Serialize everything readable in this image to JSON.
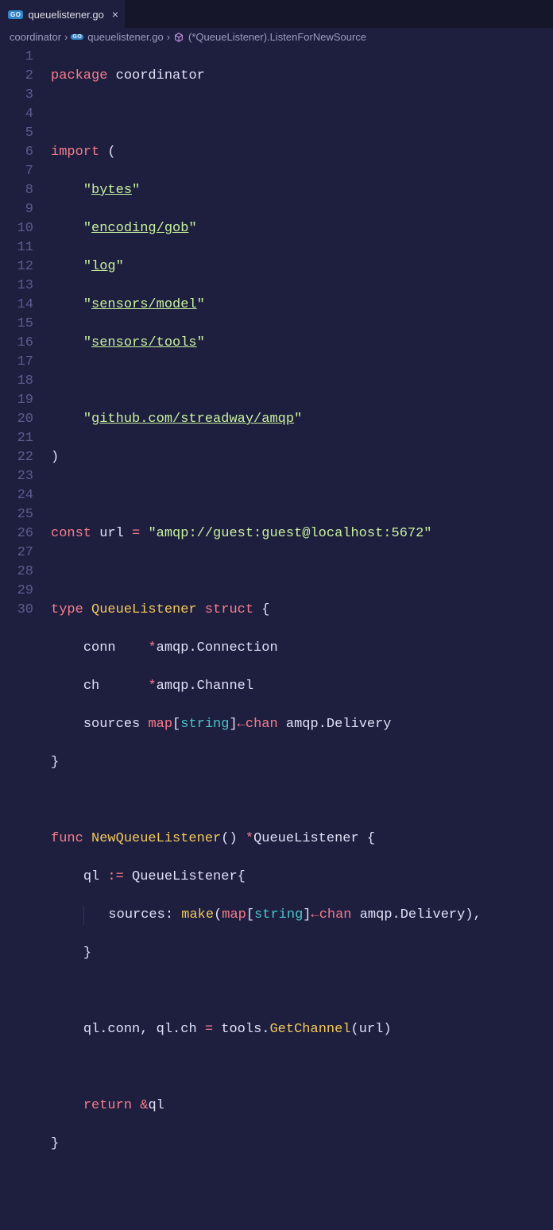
{
  "tab": {
    "filename": "queuelistener.go",
    "lang_badge": "GO"
  },
  "breadcrumbs": {
    "seg1": "coordinator",
    "seg2_badge": "GO",
    "seg2": "queuelistener.go",
    "seg3": "(*QueueListener).ListenForNewSource"
  },
  "code": {
    "l1_kw": "package",
    "l1_id": "coordinator",
    "l3_kw": "import",
    "l3_p": "(",
    "l4_q1": "\"",
    "l4_s": "bytes",
    "l4_q2": "\"",
    "l5_q1": "\"",
    "l5_s": "encoding/gob",
    "l5_q2": "\"",
    "l6_q1": "\"",
    "l6_s": "log",
    "l6_q2": "\"",
    "l7_q1": "\"",
    "l7_s": "sensors/model",
    "l7_q2": "\"",
    "l8_q1": "\"",
    "l8_s": "sensors/tools",
    "l8_q2": "\"",
    "l10_q1": "\"",
    "l10_s": "github.com/streadway/amqp",
    "l10_q2": "\"",
    "l11_p": ")",
    "l13_kw": "const",
    "l13_id": "url",
    "l13_eq": "=",
    "l13_s": "\"amqp://guest:guest@localhost:5672\"",
    "l15_kw": "type",
    "l15_id": "QueueListener",
    "l15_kw2": "struct",
    "l15_p": "{",
    "l16_id": "conn",
    "l16_star": "*",
    "l16_ty": "amqp.Connection",
    "l17_id": "ch",
    "l17_star": "*",
    "l17_ty": "amqp.Channel",
    "l18_id": "sources",
    "l18_map": "map",
    "l18_b1": "[",
    "l18_str": "string",
    "l18_b2": "]",
    "l18_arr": "←",
    "l18_chan": "chan",
    "l18_ty": "amqp.Delivery",
    "l19_p": "}",
    "l21_kw": "func",
    "l21_id": "NewQueueListener",
    "l21_p1": "()",
    "l21_star": "*",
    "l21_ty": "QueueListener",
    "l21_p2": "{",
    "l22_id": "ql",
    "l22_op": ":=",
    "l22_ty": "QueueListener",
    "l22_p": "{",
    "l23_id": "sources:",
    "l23_make": "make",
    "l23_p1": "(",
    "l23_map": "map",
    "l23_b1": "[",
    "l23_str": "string",
    "l23_b2": "]",
    "l23_arr": "←",
    "l23_chan": "chan",
    "l23_ty": "amqp.Delivery",
    "l23_p2": "),",
    "l24_p": "}",
    "l26_id1": "ql.conn",
    "l26_c": ",",
    "l26_id2": "ql.ch",
    "l26_eq": "=",
    "l26_id3": "tools.",
    "l26_fn": "GetChannel",
    "l26_p1": "(",
    "l26_arg": "url",
    "l26_p2": ")",
    "l28_kw": "return",
    "l28_amp": "&",
    "l28_id": "ql",
    "l29_p": "}"
  }
}
